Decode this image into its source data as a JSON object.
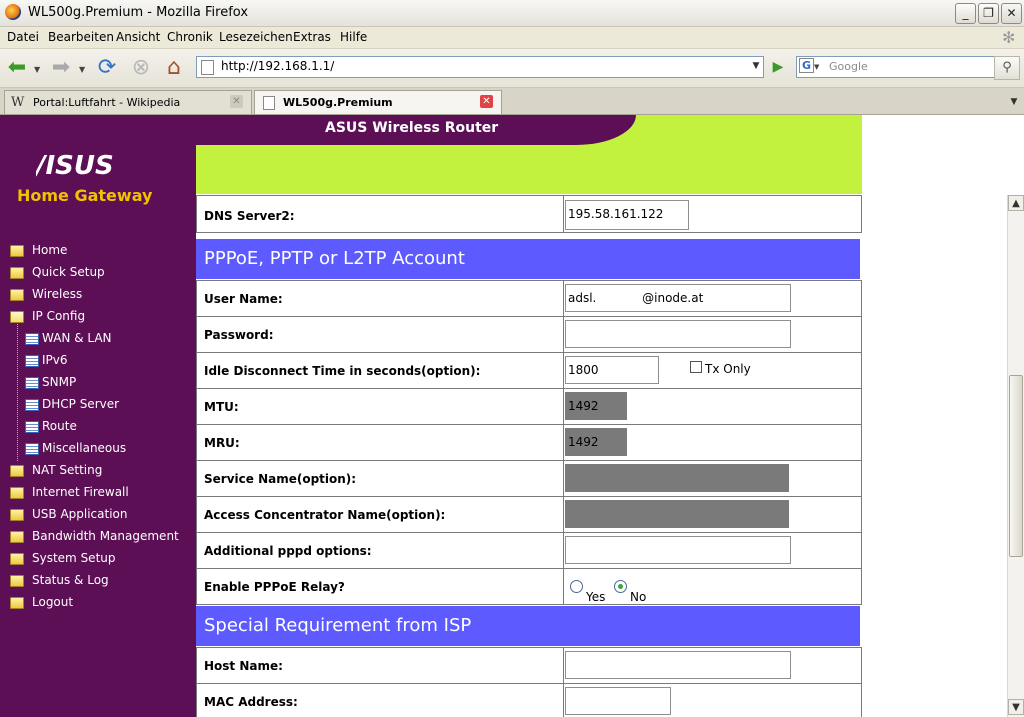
{
  "window": {
    "title": "WL500g.Premium - Mozilla Firefox",
    "minimize_icon": "minimize-icon",
    "restore_icon": "restore-icon",
    "close_icon": "close-icon"
  },
  "menubar": [
    "Datei",
    "Bearbeiten",
    "Ansicht",
    "Chronik",
    "Lesezeichen",
    "Extras",
    "Hilfe"
  ],
  "navbar": {
    "url": "http://192.168.1.1/",
    "search_engine": "G",
    "search_placeholder": "Google"
  },
  "tabs": [
    {
      "label": "Portal:Luftfahrt - Wikipedia",
      "icon": "W",
      "active": false
    },
    {
      "label": "WL500g.Premium",
      "icon": "page-icon",
      "active": true
    }
  ],
  "router": {
    "header_title": "ASUS Wireless Router",
    "logo_text": "/ISUS",
    "brand_subtitle": "Home Gateway",
    "colors": {
      "sidebar": "#5c0f55",
      "accent": "#c2f23e",
      "section": "#5d5bff",
      "brand": "#f2c200"
    }
  },
  "sidebar": {
    "items": [
      {
        "label": "Home",
        "type": "folder"
      },
      {
        "label": "Quick Setup",
        "type": "folder"
      },
      {
        "label": "Wireless",
        "type": "folder"
      },
      {
        "label": "IP Config",
        "type": "folder-open"
      },
      {
        "label": "WAN & LAN",
        "type": "page"
      },
      {
        "label": "IPv6",
        "type": "page"
      },
      {
        "label": "SNMP",
        "type": "page"
      },
      {
        "label": "DHCP Server",
        "type": "page"
      },
      {
        "label": "Route",
        "type": "page"
      },
      {
        "label": "Miscellaneous",
        "type": "page"
      },
      {
        "label": "NAT Setting",
        "type": "folder"
      },
      {
        "label": "Internet Firewall",
        "type": "folder"
      },
      {
        "label": "USB Application",
        "type": "folder"
      },
      {
        "label": "Bandwidth Management",
        "type": "folder"
      },
      {
        "label": "System Setup",
        "type": "folder"
      },
      {
        "label": "Status & Log",
        "type": "folder"
      },
      {
        "label": "Logout",
        "type": "folder"
      }
    ]
  },
  "form": {
    "dns2": {
      "label": "DNS Server2:",
      "value": "195.58.161.122"
    },
    "section_pppoe": "PPPoE, PPTP or L2TP Account",
    "username": {
      "label": "User Name:",
      "value": "adsl.            @inode.at"
    },
    "password": {
      "label": "Password:",
      "value": ""
    },
    "idle": {
      "label": "Idle Disconnect Time in seconds(option):",
      "value": "1800",
      "txonly_label": "Tx Only",
      "txonly_checked": false
    },
    "mtu": {
      "label": "MTU:",
      "value": "1492"
    },
    "mru": {
      "label": "MRU:",
      "value": "1492"
    },
    "service": {
      "label": "Service Name(option):",
      "value": ""
    },
    "concentrator": {
      "label": "Access Concentrator Name(option):",
      "value": ""
    },
    "pppd": {
      "label": "Additional pppd options:",
      "value": ""
    },
    "relay": {
      "label": "Enable PPPoE Relay?",
      "yes": "Yes",
      "no": "No",
      "selected": "No"
    },
    "section_isp": "Special Requirement from ISP",
    "hostname": {
      "label": "Host Name:",
      "value": ""
    },
    "mac": {
      "label": "MAC Address:",
      "value": ""
    }
  }
}
